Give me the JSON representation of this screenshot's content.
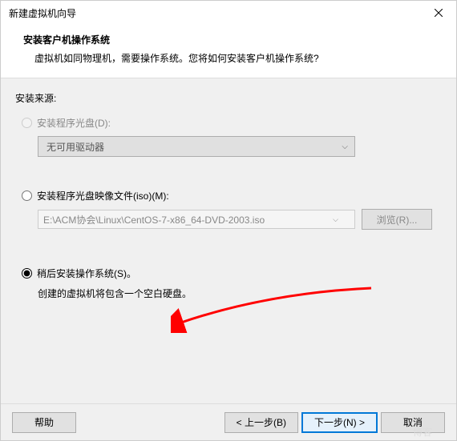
{
  "titlebar": {
    "title": "新建虚拟机向导"
  },
  "header": {
    "title": "安装客户机操作系统",
    "subtitle": "虚拟机如同物理机，需要操作系统。您将如何安装客户机操作系统?"
  },
  "section_label": "安装来源:",
  "options": {
    "disc": {
      "label": "安装程序光盘(D):",
      "drive_placeholder": "无可用驱动器"
    },
    "iso": {
      "label": "安装程序光盘映像文件(iso)(M):",
      "path": "E:\\ACM协会\\Linux\\CentOS-7-x86_64-DVD-2003.iso",
      "browse": "浏览(R)..."
    },
    "later": {
      "label": "稍后安装操作系统(S)。",
      "info": "创建的虚拟机将包含一个空白硬盘。"
    }
  },
  "footer": {
    "help": "帮助",
    "back": "< 上一步(B)",
    "next": "下一步(N) >",
    "cancel": "取消"
  },
  "watermark": "博客"
}
